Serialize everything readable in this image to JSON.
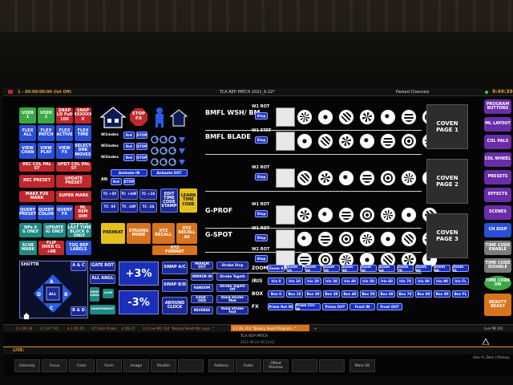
{
  "header": {
    "cue_readout": "1 - 00:00:00:00 (Int Off)",
    "title": "TCA REP PATCH 2021_6-22*",
    "right_status": "Parked Channels",
    "clock": "9:49:39"
  },
  "left_grid": [
    {
      "label": "USER\n1",
      "color": "green"
    },
    {
      "label": "USER\n2",
      "color": "green"
    },
    {
      "label": "SNAP\nLD Full\n100",
      "color": "red"
    },
    {
      "label": "SNAP\nXXXXXX\n0",
      "color": "red"
    },
    {
      "label": "FLEX\nALL",
      "color": "blue"
    },
    {
      "label": "FLEX\nPATCH",
      "color": "blue"
    },
    {
      "label": "FLEX\nACTIVE",
      "color": "blue"
    },
    {
      "label": "FLEX\nTIME",
      "color": "blue"
    },
    {
      "label": "VIEW\nCHAN",
      "color": "blue"
    },
    {
      "label": "VIEW\nPLAY",
      "color": "blue"
    },
    {
      "label": "VIEW\nFX",
      "color": "blue"
    },
    {
      "label": "SELECT\nDRK\nMOVES",
      "color": "blue"
    }
  ],
  "left_rows": {
    "row1": [
      "REC COL PAL ST",
      "UPDT COL PAL ST"
    ],
    "row2": [
      "REC PRESET",
      "UPDATE PRESET"
    ],
    "row3": [
      "MAKE P26 MARK",
      "SUPER MARK"
    ],
    "row4": [
      "QUERY\nPRESET",
      "QUERY\nCOLOR",
      "QUERY\nFX",
      "HL REM\nDIM"
    ],
    "row5": [
      "NPs 0\nG ONLY",
      "UPDATE\nIG ONLY",
      "UPDATE\nLAST TIME\nBLOCK 0 ONLY"
    ],
    "row6": [
      "SCHE\nMARK",
      "FLIP\nOVER CL +0R",
      "TOG REP\nLABELS"
    ]
  },
  "fx_panel": {
    "stop_fx": "STOP\nFX",
    "rows": [
      {
        "label": "W1index",
        "b1": "Rnt",
        "b2": "STOP"
      },
      {
        "label": "W2index",
        "b1": "Rnt",
        "b2": "STOP"
      },
      {
        "label": "W3index",
        "b1": "Rnt",
        "b2": "STOP"
      }
    ],
    "an_label": "AN",
    "animate_in": "Animate IN",
    "animate_out": "Animate OUT",
    "tc_buttons": [
      "TC +5F",
      "TC +10F",
      "TC +1S",
      "TC -5F",
      "TC -10F",
      "TC -1S"
    ],
    "edit_tc": "EDIT\nTIME\nCODE\nSTAMP",
    "learn_tc": "LEARN\nTIME\nCODE",
    "preheat": "PREHEAT",
    "staging": "STAGING\nMODE",
    "xyz_recall": "XYZ\nRECALL",
    "xyz_recall_all": "XYZ\nRECALL\nAll",
    "xyz_format": "XYZ\nFORMAT"
  },
  "fixtures": [
    {
      "name": "BMFL WSH/ BM",
      "wheel": "W1 ROT",
      "btn": "Stop",
      "gobos": 7
    },
    {
      "name": "BMFL BLADE",
      "wheel": "W1 STAT",
      "btn": "Stop",
      "gobos": 7
    },
    {
      "name": "",
      "wheel": "W2 ROT",
      "btn": "Stop",
      "gobos": 7
    },
    {
      "name": "G-PROF",
      "wheel": "W1 ROT",
      "btn": "Stop",
      "gobos": 7
    },
    {
      "name": "G-SPOT",
      "wheel": "W1 ROT",
      "btn": "Stop",
      "gobos": 7
    },
    {
      "name": "",
      "wheel": "W2 ROT",
      "btn": "Stop",
      "gobos": 7
    }
  ],
  "coven": [
    "COVEN\nPAGE 1",
    "COVEN\nPAGE 2",
    "COVEN\nPAGE 3"
  ],
  "bottom_left": {
    "shutter": "SHUTTR",
    "a_c": "A & C",
    "gate_rot": "GATE ROT",
    "all_angl": "ALL ANGL",
    "b_d": "B & D",
    "all": "ALL",
    "dir_a": "A",
    "dir_b": "B",
    "dir_c": "C",
    "dir_d": "D",
    "small1": "SWAP\nGOBOS",
    "small2": "CAGE",
    "small3": "INDEPENDENT",
    "plus3": "+3%",
    "minus3": "-3%",
    "swap_ac": "SWAP A/C",
    "swap_bd": "SWAP B/D",
    "around_clock": "AROUND\nCLOCK",
    "mirror_out": "MIRROR OUT",
    "mirror_in": "MIRROR IN",
    "random": "RANDOM",
    "even_odd": "EVEN - ODD",
    "reverse": "REVERSE",
    "strobe_stop": "Strobe Stop",
    "strobe_togeth": "Strobe Togeth",
    "strobe_togeth_off": "Strobe Togeth Off",
    "rand_strobe_med": "Rand Strobe Med",
    "rand_strobe_fast": "Rand Strobe Fast"
  },
  "zoom_row": {
    "label": "ZOOM",
    "items": [
      "Zoom 0",
      "Zoom 10",
      "Zoom 20",
      "Zoom 30",
      "Zoom 40",
      "Zoom 50",
      "Zoom 60",
      "Zoom 70",
      "Zoom 80",
      "Zoom 90",
      "Zoom FL"
    ]
  },
  "iris_row": {
    "label": "IRIS",
    "items": [
      "Iris 0",
      "Iris 10",
      "Iris 20",
      "Iris 30",
      "Iris 40",
      "Iris 50",
      "Iris 60",
      "Iris 70",
      "Iris 80",
      "Iris 90",
      "Iris FL"
    ]
  },
  "box_row": {
    "label": "BOX",
    "items": [
      "Box 0",
      "Box 10",
      "Box 20",
      "Box 30",
      "Box 40",
      "Box 50",
      "Box 60",
      "Box 70",
      "Box 80",
      "Box 90",
      "Box FL"
    ]
  },
  "fx_row": {
    "label": "FX",
    "items": [
      "Prism Rot IN",
      "Prism Circ IN",
      "Prism OUT",
      "Frost IN",
      "Frost OUT"
    ]
  },
  "sidebar": [
    {
      "label": "PROGRAM\nBUTTONS",
      "color": "purple"
    },
    {
      "label": "ML LAYOUT",
      "color": "purple"
    },
    {
      "label": "COL PALS",
      "color": "purple"
    },
    {
      "label": "COL WHEEL",
      "color": "purple"
    },
    {
      "label": "PRESETS",
      "color": "purple"
    },
    {
      "label": "EFFECTS",
      "color": "purple"
    },
    {
      "label": "SCENES",
      "color": "purple"
    },
    {
      "label": "CH DISP",
      "color": "blue"
    },
    {
      "label": "TIME CODE\nENABLE",
      "color": "grey"
    },
    {
      "label": "TIME CODE\nDISABLE",
      "color": "grey"
    },
    {
      "label": "TIME CODE\nON",
      "color": "green"
    },
    {
      "label": "BEAUTY\nBEAST",
      "color": "orange"
    }
  ],
  "tabs": [
    "4.3 DS 18",
    "3.1 M 7 SC",
    "4.3 DS 20",
    "27 Color Picker",
    "4 DS 27",
    "3.4 Live M1 104 \"Beauty Beast ML Layo...\"",
    "3.2 ML 103 \"Beauty Beast Program...\""
  ],
  "tab_new": "+",
  "footer_title": "TCA REP PATCH",
  "footer_date": "2021-06-22 09:13:42",
  "footer_right": "Live PB 101",
  "live_label": "LIVE:",
  "bottom_buttons": [
    "Intensity",
    "Focus",
    "Color",
    "Form",
    "Image",
    "Shutter",
    "",
    "Address",
    "Fader",
    "Offset\nPreview",
    "",
    "",
    "More SK"
  ],
  "status_right": "User 9 | Dark | Primary"
}
